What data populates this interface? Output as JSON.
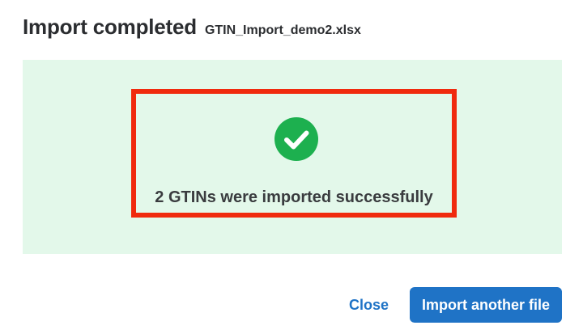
{
  "dialog": {
    "title": "Import completed",
    "filename": "GTIN_Import_demo2.xlsx"
  },
  "result": {
    "icon": "check-circle-icon",
    "message": "2 GTINs were imported successfully"
  },
  "footer": {
    "close_label": "Close",
    "import_another_label": "Import another file"
  },
  "colors": {
    "panel_background": "#e3f8ea",
    "success_icon": "#1db04f",
    "highlight_border": "#f02a0e",
    "accent": "#1f73c6"
  }
}
